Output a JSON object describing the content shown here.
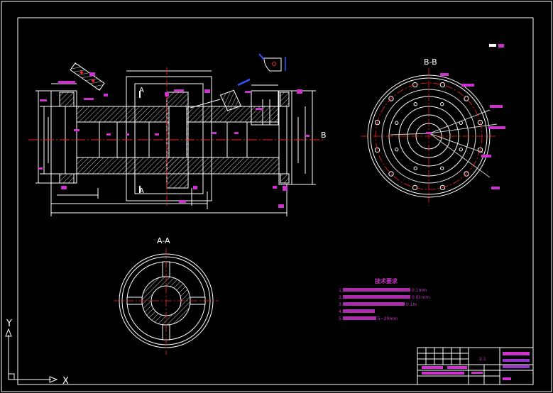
{
  "colors": {
    "background": "#000000",
    "lines": "#ffffff",
    "center_lines": "#ff2020",
    "dimensions": "#cc33cc",
    "hatching": "#dddddd",
    "blue_annotation": "#3355ff",
    "border": "#ffffff"
  },
  "views": {
    "section_aa_label": "A-A",
    "section_bb_label": "B-B",
    "cut_label_a": "A",
    "cut_label_b": "B"
  },
  "technical_requirements": {
    "title": "技术要求",
    "items": [
      "1.",
      "2.",
      "3.",
      "4.",
      "5."
    ],
    "fragments": [
      "0.1mm",
      "0.01mm",
      "0.1m",
      "5~20mm"
    ]
  },
  "ucs": {
    "x_label": "X",
    "y_label": "Y"
  },
  "title_block": {
    "scale": "2:1"
  }
}
